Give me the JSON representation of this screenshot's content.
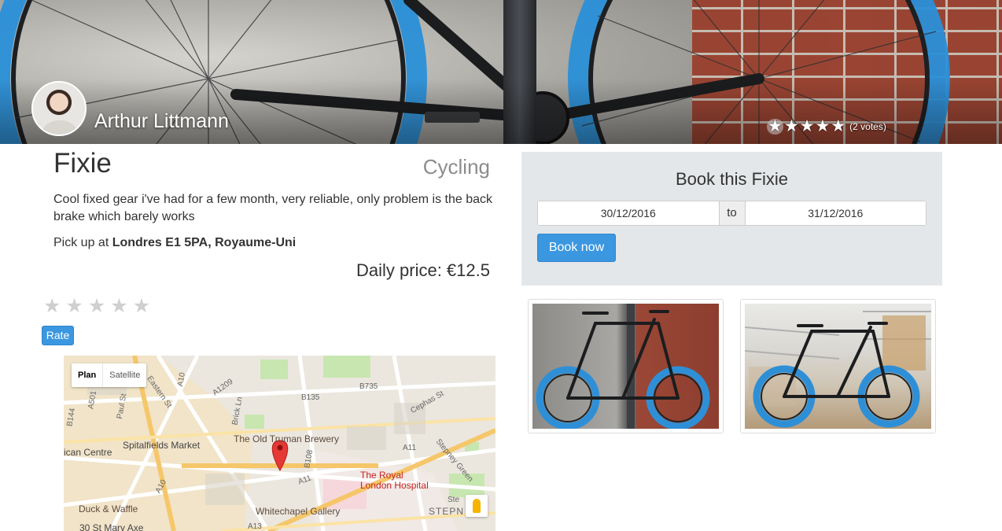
{
  "owner": {
    "name": "Arthur Littmann"
  },
  "rating": {
    "stars": 5,
    "votes_label": "(2 votes)"
  },
  "listing": {
    "title": "Fixie",
    "category": "Cycling",
    "description": "Cool fixed gear i've had for a few month, very reliable, only problem is the back brake which barely works",
    "pickup_prefix": "Pick up at ",
    "pickup_location": "Londres E1 5PA, Royaume-Uni",
    "price_label": "Daily price: €12.5"
  },
  "user_rating": {
    "max_stars": 5,
    "selected": 0,
    "rate_label": "Rate"
  },
  "booking": {
    "title": "Book this Fixie",
    "start_date": "30/12/2016",
    "separator": "to",
    "end_date": "31/12/2016",
    "button_label": "Book now"
  },
  "map": {
    "view_plan": "Plan",
    "view_satellite": "Satellite",
    "labels": {
      "spitalfields": "Spitalfields Market",
      "truman": "The Old Truman Brewery",
      "hospital_1": "The Royal",
      "hospital_2": "London Hospital",
      "duck": "Duck & Waffle",
      "whitechapel": "Whitechapel Gallery",
      "centre": "ican Centre",
      "mary_axe": "30 St Mary Axe",
      "stepney_green": "Stepney Green",
      "stepn": "STEPN",
      "eastern": "Eastern St",
      "cephas": "Cephas St",
      "brick_ln": "Brick Ln",
      "a10_1": "A10",
      "a10_2": "A10",
      "a1209": "A1209",
      "b135": "B135",
      "b735": "B735",
      "a11_1": "A11",
      "a11_2": "A11",
      "b108": "B108",
      "a13": "A13",
      "a501": "A501",
      "b144": "B144",
      "paul": "Paul St",
      "ste": "Ste"
    }
  },
  "icons": {
    "star": "star-icon",
    "map_marker": "map-marker-icon",
    "pegman": "pegman-icon"
  },
  "colors": {
    "accent": "#3b97e0",
    "panel": "#e4e7e9",
    "wheel_blue": "#2f8fd6"
  }
}
